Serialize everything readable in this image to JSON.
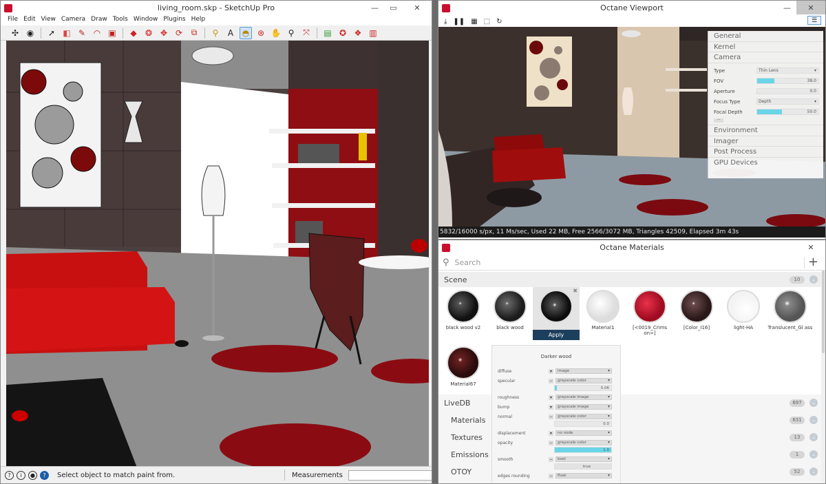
{
  "sketchup": {
    "title": "living_room.skp - SketchUp Pro",
    "menus": [
      "File",
      "Edit",
      "View",
      "Camera",
      "Draw",
      "Tools",
      "Window",
      "Plugins",
      "Help"
    ],
    "status_text": "Select object to match paint from.",
    "measurements_label": "Measurements"
  },
  "viewport": {
    "title": "Octane Viewport",
    "status": "5832/16000 s/px, 11 Ms/sec, Used 22 MB, Free 2566/3072 MB, Triangles 42509, Elapsed 3m 43s",
    "panel": {
      "sections_top": [
        "General",
        "Kernel",
        "Camera"
      ],
      "camera_rows": [
        {
          "label": "Type",
          "value": "Thin Lens",
          "kind": "dropdown"
        },
        {
          "label": "FOV",
          "value": "38.0",
          "fill": 0.28,
          "kind": "slider"
        },
        {
          "label": "Aperture",
          "value": "0.0",
          "fill": 0,
          "kind": "slider"
        },
        {
          "label": "Focus Type",
          "value": "Depth",
          "kind": "dropdown"
        },
        {
          "label": "Focal Depth",
          "value": "50.0",
          "fill": 0.4,
          "kind": "slider"
        }
      ],
      "more": "···",
      "sections_bottom": [
        "Environment",
        "Imager",
        "Post Process",
        "GPU Devices"
      ]
    }
  },
  "materials": {
    "title": "Octane Materials",
    "search_placeholder": "Search",
    "scene_label": "Scene",
    "scene_count": "10",
    "items": [
      {
        "name": "black wood v2",
        "color": "#1a1a1a"
      },
      {
        "name": "black wood",
        "color": "#222"
      },
      {
        "name": "",
        "color": "#111"
      },
      {
        "name": "Material1",
        "color": "#eee"
      },
      {
        "name": "[<0019_Crims on>]",
        "color": "#c0102a"
      },
      {
        "name": "[Color_I16]",
        "color": "#3a2020"
      },
      {
        "name": "light-HA",
        "color": "#f6f6f6"
      },
      {
        "name": "Translucent_Gl ass",
        "color": "#666"
      },
      {
        "name": "Material67",
        "color": "#3a1515"
      }
    ],
    "apply_label": "Apply",
    "editor": {
      "title": "Darker wood",
      "rows": [
        {
          "name": "diffuse",
          "value": "image"
        },
        {
          "name": "specular",
          "value": "grayscale color",
          "slider": "0.06",
          "fill": 0.04
        },
        {
          "name": "roughness",
          "value": "grayscale image"
        },
        {
          "name": "bump",
          "value": "grayscale image"
        },
        {
          "name": "normal",
          "value": "grayscale color",
          "slider": "0.0",
          "fill": 0
        },
        {
          "name": "displacement",
          "value": "no node"
        },
        {
          "name": "opacity",
          "value": "grayscale color",
          "slider": "1.0",
          "fill": 1
        },
        {
          "name": "smooth",
          "value": "bool",
          "slider": "true",
          "fill": 0
        },
        {
          "name": "edges rounding",
          "value": "float"
        }
      ]
    },
    "livedb": {
      "label": "LiveDB",
      "count": "697",
      "children": [
        {
          "name": "Materials",
          "count": "631"
        },
        {
          "name": "Textures",
          "count": "13"
        },
        {
          "name": "Emissions",
          "count": "1"
        },
        {
          "name": "OTOY",
          "count": "52"
        }
      ]
    }
  }
}
